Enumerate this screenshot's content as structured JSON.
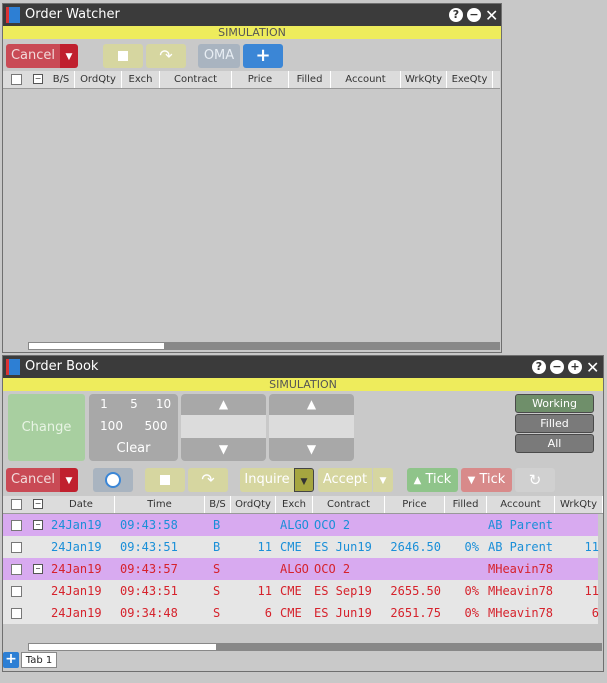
{
  "order_watcher": {
    "title": "Order Watcher",
    "simulation_label": "SIMULATION",
    "cancel_label": "Cancel",
    "oma_label": "OMA",
    "plus_label": "+",
    "columns": [
      "B/S",
      "OrdQty",
      "Exch",
      "Contract",
      "Price",
      "Filled",
      "Account",
      "WrkQty",
      "ExeQty"
    ]
  },
  "order_book": {
    "title": "Order Book",
    "simulation_label": "SIMULATION",
    "change_label": "Change",
    "qty_buttons": [
      "1",
      "5",
      "10",
      "100",
      "500"
    ],
    "clear_label": "Clear",
    "filters": [
      "Working",
      "Filled",
      "All"
    ],
    "cancel_label": "Cancel",
    "inquire_label": "Inquire",
    "accept_label": "Accept",
    "tick_up_label": "Tick",
    "tick_down_label": "Tick",
    "columns": [
      "Date",
      "Time",
      "B/S",
      "OrdQty",
      "Exch",
      "Contract",
      "Price",
      "Filled",
      "Account",
      "WrkQty"
    ],
    "rows": [
      {
        "date": "24Jan19",
        "time": "09:43:58",
        "bs": "B",
        "qty": "",
        "exch": "ALGO",
        "contract": "OCO 2",
        "price": "",
        "filled": "",
        "account": "AB Parent",
        "wrk": ""
      },
      {
        "date": "24Jan19",
        "time": "09:43:51",
        "bs": "B",
        "qty": "11",
        "exch": "CME",
        "contract": "ES Jun19",
        "price": "2646.50",
        "filled": "0%",
        "account": "AB Parent",
        "wrk": "11"
      },
      {
        "date": "24Jan19",
        "time": "09:43:57",
        "bs": "S",
        "qty": "",
        "exch": "ALGO",
        "contract": "OCO 2",
        "price": "",
        "filled": "",
        "account": "MHeavin78'",
        "wrk": ""
      },
      {
        "date": "24Jan19",
        "time": "09:43:51",
        "bs": "S",
        "qty": "11",
        "exch": "CME",
        "contract": "ES Sep19",
        "price": "2655.50",
        "filled": "0%",
        "account": "MHeavin78'",
        "wrk": "11"
      },
      {
        "date": "24Jan19",
        "time": "09:34:48",
        "bs": "S",
        "qty": "6",
        "exch": "CME",
        "contract": "ES Jun19",
        "price": "2651.75",
        "filled": "0%",
        "account": "MHeavin78'",
        "wrk": "6"
      }
    ],
    "tab_label": "Tab 1",
    "add_tab_label": "+"
  },
  "colors": {
    "simulation_bar": "#eeec5c",
    "parent_row": "#d8aaf0",
    "buy_text": "#1a8fd8",
    "sell_text": "#d6222c",
    "cancel": "#c0202e",
    "accent_blue": "#3b86d6"
  }
}
